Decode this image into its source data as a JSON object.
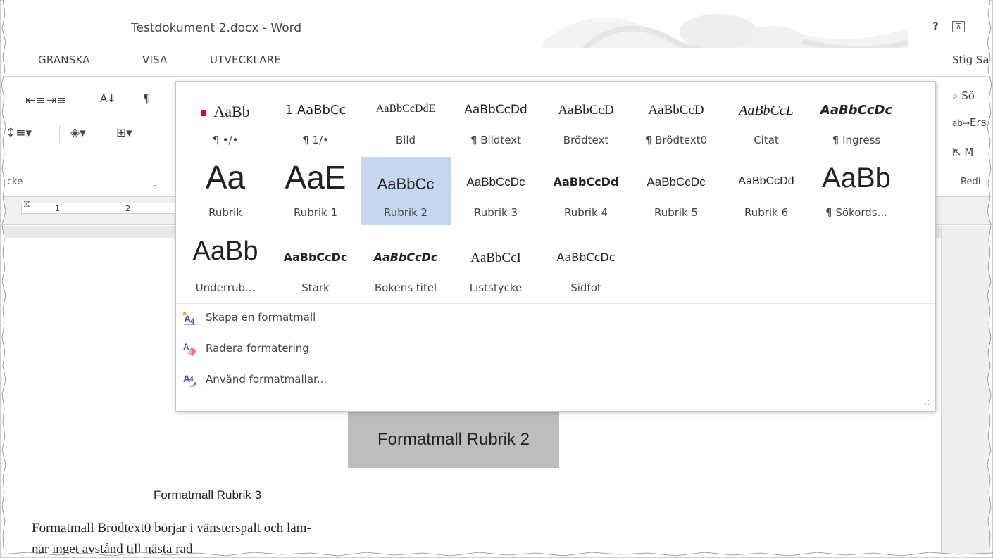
{
  "window": {
    "title": "Testdokument 2.docx - Word",
    "help": "?",
    "ribbon_display": "⊼"
  },
  "tabs": [
    {
      "label": "GRANSKA"
    },
    {
      "label": "VISA"
    },
    {
      "label": "UTVECKLARE"
    }
  ],
  "user": "Stig Sang",
  "ribbon": {
    "paragraph_group_label": "cke",
    "right_items": {
      "search": "Sö",
      "replace": "Ers",
      "select": "M",
      "group_label": "Redi"
    }
  },
  "ruler": {
    "numbers": [
      "1",
      "2"
    ]
  },
  "styles_gallery": {
    "styles": [
      {
        "preview": "AaBb",
        "name": "¶ •/•"
      },
      {
        "preview": "1 AaBbCc",
        "name": "¶ 1/•"
      },
      {
        "preview": "AaBbCcDdE",
        "name": "Bild"
      },
      {
        "preview": "AaBbCcDd",
        "name": "¶ Bildtext"
      },
      {
        "preview": "AaBbCcD",
        "name": "Brödtext"
      },
      {
        "preview": "AaBbCcD",
        "name": "¶ Brödtext0"
      },
      {
        "preview": "AaBbCcL",
        "name": "Citat"
      },
      {
        "preview": "AaBbCcDc",
        "name": "¶ Ingress"
      },
      {
        "preview": "Aa",
        "name": "Rubrik"
      },
      {
        "preview": "AaE",
        "name": "Rubrik 1"
      },
      {
        "preview": "AaBbCc",
        "name": "Rubrik 2"
      },
      {
        "preview": "AaBbCcDc",
        "name": "Rubrik 3"
      },
      {
        "preview": "AaBbCcDd",
        "name": "Rubrik 4"
      },
      {
        "preview": "AaBbCcDc",
        "name": "Rubrik 5"
      },
      {
        "preview": "AaBbCcDd",
        "name": "Rubrik 6"
      },
      {
        "preview": "AaBb",
        "name": "¶ Sökords..."
      },
      {
        "preview": "AaBb",
        "name": "Underrub..."
      },
      {
        "preview": "AaBbCcDc",
        "name": "Stark"
      },
      {
        "preview": "AaBbCcDc",
        "name": "Bokens titel"
      },
      {
        "preview": "AaBbCcI",
        "name": "Liststycke"
      },
      {
        "preview": "AaBbCcDc",
        "name": "Sidfot"
      }
    ],
    "selected": "Rubrik 2",
    "commands": [
      {
        "label": "Skapa en formatmall",
        "icon": "create-style-icon"
      },
      {
        "label": "Radera formatering",
        "icon": "clear-formatting-icon"
      },
      {
        "label": "Använd formatmallar...",
        "icon": "apply-styles-icon"
      }
    ],
    "accent": "#c5d6ef"
  },
  "document": {
    "heading2": "Formatmall Rubrik 2",
    "heading3": "Formatmall Rubrik 3",
    "body_line1": "Formatmall Brödtext0 börjar i vänsterspalt och läm-",
    "body_line2": "nar inget avstånd till nästa rad"
  }
}
